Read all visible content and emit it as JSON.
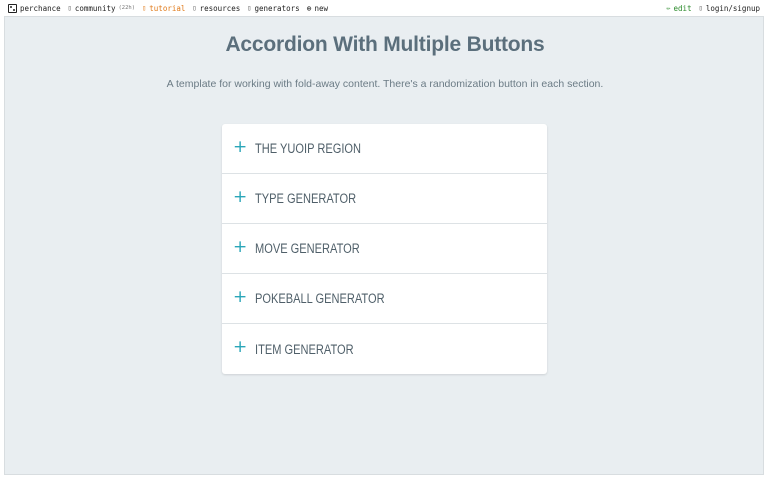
{
  "topbar": {
    "brand": "perchance",
    "community": "community",
    "community_badge": "(22h)",
    "tutorial": "tutorial",
    "resources": "resources",
    "generators": "generators",
    "new": "new",
    "edit": "edit",
    "login": "login/signup"
  },
  "colors": {
    "page_bg": "#e9eef1",
    "title": "#5b6f7c",
    "accent": "#2aa6b8",
    "tutorial_link": "#e07a1a",
    "edit_link": "#2a8a2a"
  },
  "page": {
    "title": "Accordion With Multiple Buttons",
    "subtitle": "A template for working with fold-away content. There's a randomization button in each section."
  },
  "accordion": {
    "items": [
      {
        "label": "THE YUOIP REGION"
      },
      {
        "label": "TYPE GENERATOR"
      },
      {
        "label": "MOVE GENERATOR"
      },
      {
        "label": "POKEBALL GENERATOR"
      },
      {
        "label": "ITEM GENERATOR"
      }
    ]
  }
}
